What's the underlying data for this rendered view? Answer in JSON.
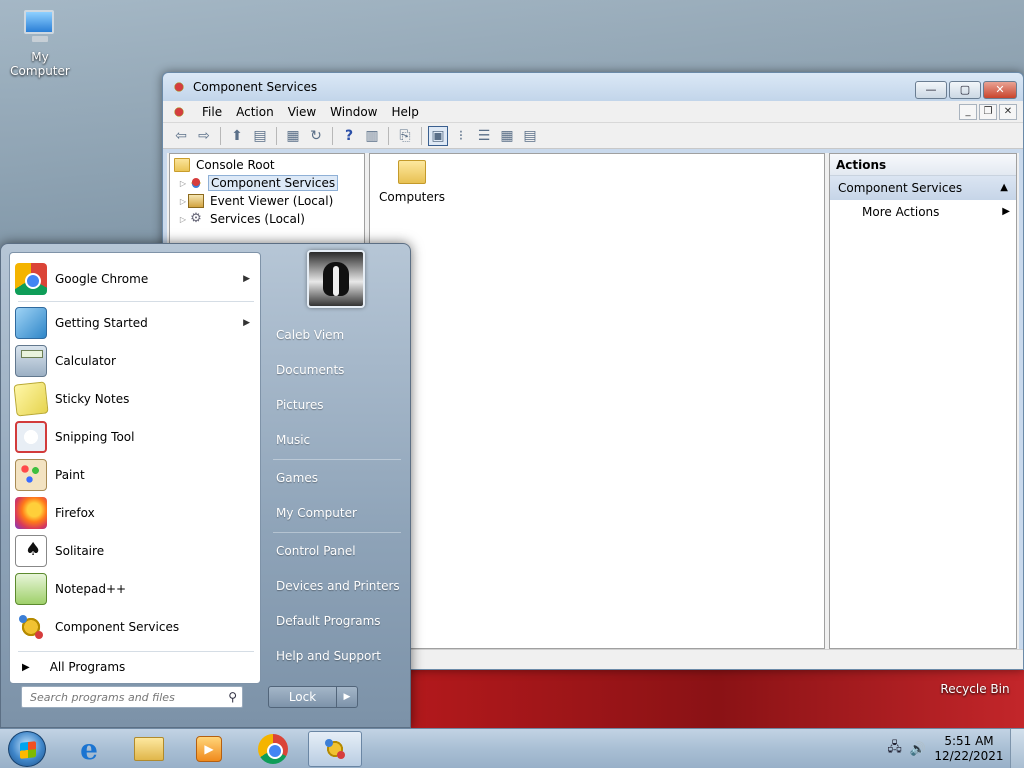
{
  "desktop": {
    "icons": [
      {
        "label": "My Computer",
        "icon": "computer-icon"
      },
      {
        "label": "Recycle Bin",
        "icon": "recycle-bin-icon"
      }
    ]
  },
  "window": {
    "title": "Component Services",
    "caption": {
      "minimize": "—",
      "maximize": "▢",
      "close": "✕"
    },
    "menu": [
      "File",
      "Action",
      "View",
      "Window",
      "Help"
    ],
    "mdi": {
      "minimize": "_",
      "restore": "❐",
      "close": "✕"
    },
    "toolbar_icons": [
      "back-icon",
      "forward-icon",
      "up-icon",
      "show-hide-tree-icon",
      "properties-icon",
      "refresh-icon",
      "help-icon",
      "show-hide-action-pane-icon",
      "export-icon",
      "large-icons-view-icon",
      "small-icons-view-icon",
      "list-view-icon",
      "detail-view-icon",
      "configure-icon"
    ],
    "tree": [
      {
        "label": "Console Root",
        "icon": "folder-icon",
        "expanded": true,
        "level": 0
      },
      {
        "label": "Component Services",
        "icon": "component-services-icon",
        "selected": true,
        "level": 1
      },
      {
        "label": "Event Viewer (Local)",
        "icon": "event-viewer-icon",
        "level": 1
      },
      {
        "label": "Services (Local)",
        "icon": "gear-icon",
        "level": 1
      }
    ],
    "main_items": [
      {
        "label": "Computers",
        "icon": "folder-icon"
      }
    ],
    "actions": {
      "header": "Actions",
      "section": "Component Services",
      "items": [
        "More Actions"
      ]
    }
  },
  "start_menu": {
    "pinned": [
      {
        "label": "Google Chrome",
        "icon": "chrome-icon",
        "submenu": true
      },
      {
        "label": "Getting Started",
        "icon": "getting-started-icon",
        "submenu": true
      },
      {
        "label": "Calculator",
        "icon": "calculator-icon"
      },
      {
        "label": "Sticky Notes",
        "icon": "sticky-notes-icon"
      },
      {
        "label": "Snipping Tool",
        "icon": "snipping-tool-icon"
      },
      {
        "label": "Paint",
        "icon": "paint-icon"
      },
      {
        "label": "Firefox",
        "icon": "firefox-icon"
      },
      {
        "label": "Solitaire",
        "icon": "solitaire-icon"
      },
      {
        "label": "Notepad++",
        "icon": "notepad-plus-plus-icon"
      },
      {
        "label": "Component Services",
        "icon": "component-services-icon"
      }
    ],
    "all_programs": "All Programs",
    "search_placeholder": "Search programs and files",
    "right_items": [
      "Caleb Viem",
      "Documents",
      "Pictures",
      "Music",
      "Games",
      "My Computer",
      "Control Panel",
      "Devices and Printers",
      "Default Programs",
      "Help and Support"
    ],
    "lock_label": "Lock",
    "lock_arrow": "▶"
  },
  "taskbar": {
    "apps": [
      {
        "name": "internet-explorer",
        "icon": "internet-explorer-icon"
      },
      {
        "name": "windows-explorer",
        "icon": "folder-icon"
      },
      {
        "name": "media-player",
        "icon": "media-player-icon"
      },
      {
        "name": "google-chrome",
        "icon": "chrome-icon"
      },
      {
        "name": "component-services",
        "icon": "component-services-icon",
        "active": true
      }
    ],
    "time": "5:51 AM",
    "date": "12/22/2021"
  }
}
